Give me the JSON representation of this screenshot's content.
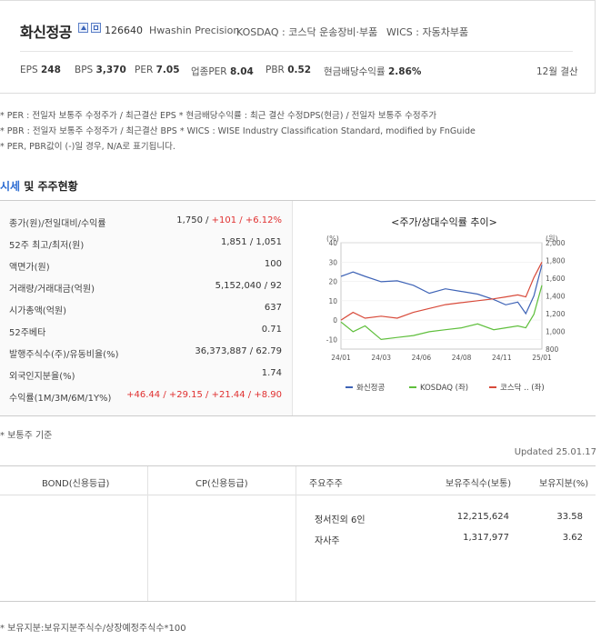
{
  "header": {
    "company_name": "화신정공",
    "code": "126640",
    "english_name": "Hwashin Precision",
    "market": "KOSDAQ : 코스닥 운송장비·부품",
    "wics": "WICS : 자동차부품",
    "metrics": [
      {
        "label": "EPS",
        "value": "248"
      },
      {
        "label": "BPS",
        "value": "3,370"
      },
      {
        "label": "PER",
        "value": "7.05"
      },
      {
        "label": "업종PER",
        "value": "8.04"
      },
      {
        "label": "PBR",
        "value": "0.52"
      },
      {
        "label": "현금배당수익률",
        "value": "2.86%"
      }
    ],
    "fiscal": "12월 결산"
  },
  "notes": [
    "* PER : 전일자 보통주 수정주가 / 최근결산 EPS * 현금배당수익률 : 최근 결산 수정DPS(현금) / 전일자 보통주 수정주가",
    "* PBR : 전일자 보통주 수정주가 / 최근결산 BPS * WICS : WISE Industry Classification Standard, modified by FnGuide",
    "* PER, PBR값이 (-)일 경우, N/A로 표기됩니다."
  ],
  "section": {
    "title_highlight": "시세",
    "title_rest": " 및 주주현황"
  },
  "quote_rows": [
    {
      "label": "종가(원)/전일대비/수익률",
      "value": "1,750 / ",
      "value_red": "+101 / +6.12%"
    },
    {
      "label": "52주 최고/최저(원)",
      "value": "1,851 / 1,051"
    },
    {
      "label": "액면가(원)",
      "value": "100"
    },
    {
      "label": "거래량/거래대금(억원)",
      "value": "5,152,040 / 92"
    },
    {
      "label": "시가총액(억원)",
      "value": "637"
    },
    {
      "label": "52주베타",
      "value": "0.71"
    },
    {
      "label": "발행주식수(주)/유동비율(%)",
      "value": "36,373,887 / 62.79"
    },
    {
      "label": "외국인지분율(%)",
      "value": "1.74"
    },
    {
      "label": "수익률(1M/3M/6M/1Y%)",
      "value": "",
      "value_red": "+46.44 / +29.15 / +21.44 / +8.90"
    }
  ],
  "chart_data": {
    "type": "line",
    "title": "<주가/상대수익률 추이>",
    "left_unit": "(%)",
    "right_unit": "(원)",
    "x_ticks": [
      "24/01",
      "24/03",
      "24/06",
      "24/08",
      "24/11",
      "25/01"
    ],
    "y_left_ticks": [
      "40",
      "30",
      "20",
      "10",
      "0",
      "-10"
    ],
    "y_right_ticks": [
      "2,000",
      "1,800",
      "1,600",
      "1,400",
      "1,200",
      "1,000",
      "800"
    ],
    "ylim_left": [
      -15,
      40
    ],
    "ylim_right": [
      800,
      2000
    ],
    "series": [
      {
        "name": "화신정공",
        "axis": "right",
        "color": "#3e63b6",
        "x": [
          0,
          0.06,
          0.12,
          0.2,
          0.28,
          0.36,
          0.44,
          0.52,
          0.6,
          0.68,
          0.76,
          0.82,
          0.88,
          0.92,
          0.96,
          1.0
        ],
        "values": [
          1620,
          1670,
          1620,
          1560,
          1570,
          1520,
          1430,
          1480,
          1450,
          1420,
          1360,
          1300,
          1330,
          1200,
          1400,
          1750
        ]
      },
      {
        "name": "KOSDAQ (좌)",
        "axis": "left",
        "color": "#5fbf3c",
        "x": [
          0,
          0.06,
          0.12,
          0.2,
          0.28,
          0.36,
          0.44,
          0.52,
          0.6,
          0.68,
          0.76,
          0.82,
          0.88,
          0.92,
          0.96,
          1.0
        ],
        "values": [
          -1,
          -6,
          -3,
          -10,
          -9,
          -8,
          -6,
          -5,
          -4,
          -2,
          -5,
          -4,
          -3,
          -4,
          3,
          18
        ]
      },
      {
        "name": "코스닥 .. (좌)",
        "axis": "left",
        "color": "#d84a3a",
        "x": [
          0,
          0.06,
          0.12,
          0.2,
          0.28,
          0.36,
          0.44,
          0.52,
          0.6,
          0.68,
          0.76,
          0.82,
          0.88,
          0.92,
          0.96,
          1.0
        ],
        "values": [
          0,
          4,
          1,
          2,
          1,
          4,
          6,
          8,
          9,
          10,
          11,
          12,
          13,
          12,
          22,
          30
        ]
      }
    ]
  },
  "base_note": "* 보통주 기준",
  "updated": "Updated 25.01.17",
  "lower_headers": {
    "bond": "BOND(신용등급)",
    "cp": "CP(신용등급)",
    "holder": "주요주주",
    "shares": "보유주식수(보통)",
    "ratio": "보유지분(%)"
  },
  "shareholders": [
    {
      "name": "정서진외 6인",
      "shares": "12,215,624",
      "ratio": "33.58"
    },
    {
      "name": "자사주",
      "shares": "1,317,977",
      "ratio": "3.62"
    }
  ],
  "footer_note": "* 보유지분:보유지분주식수/상장예정주식수*100"
}
